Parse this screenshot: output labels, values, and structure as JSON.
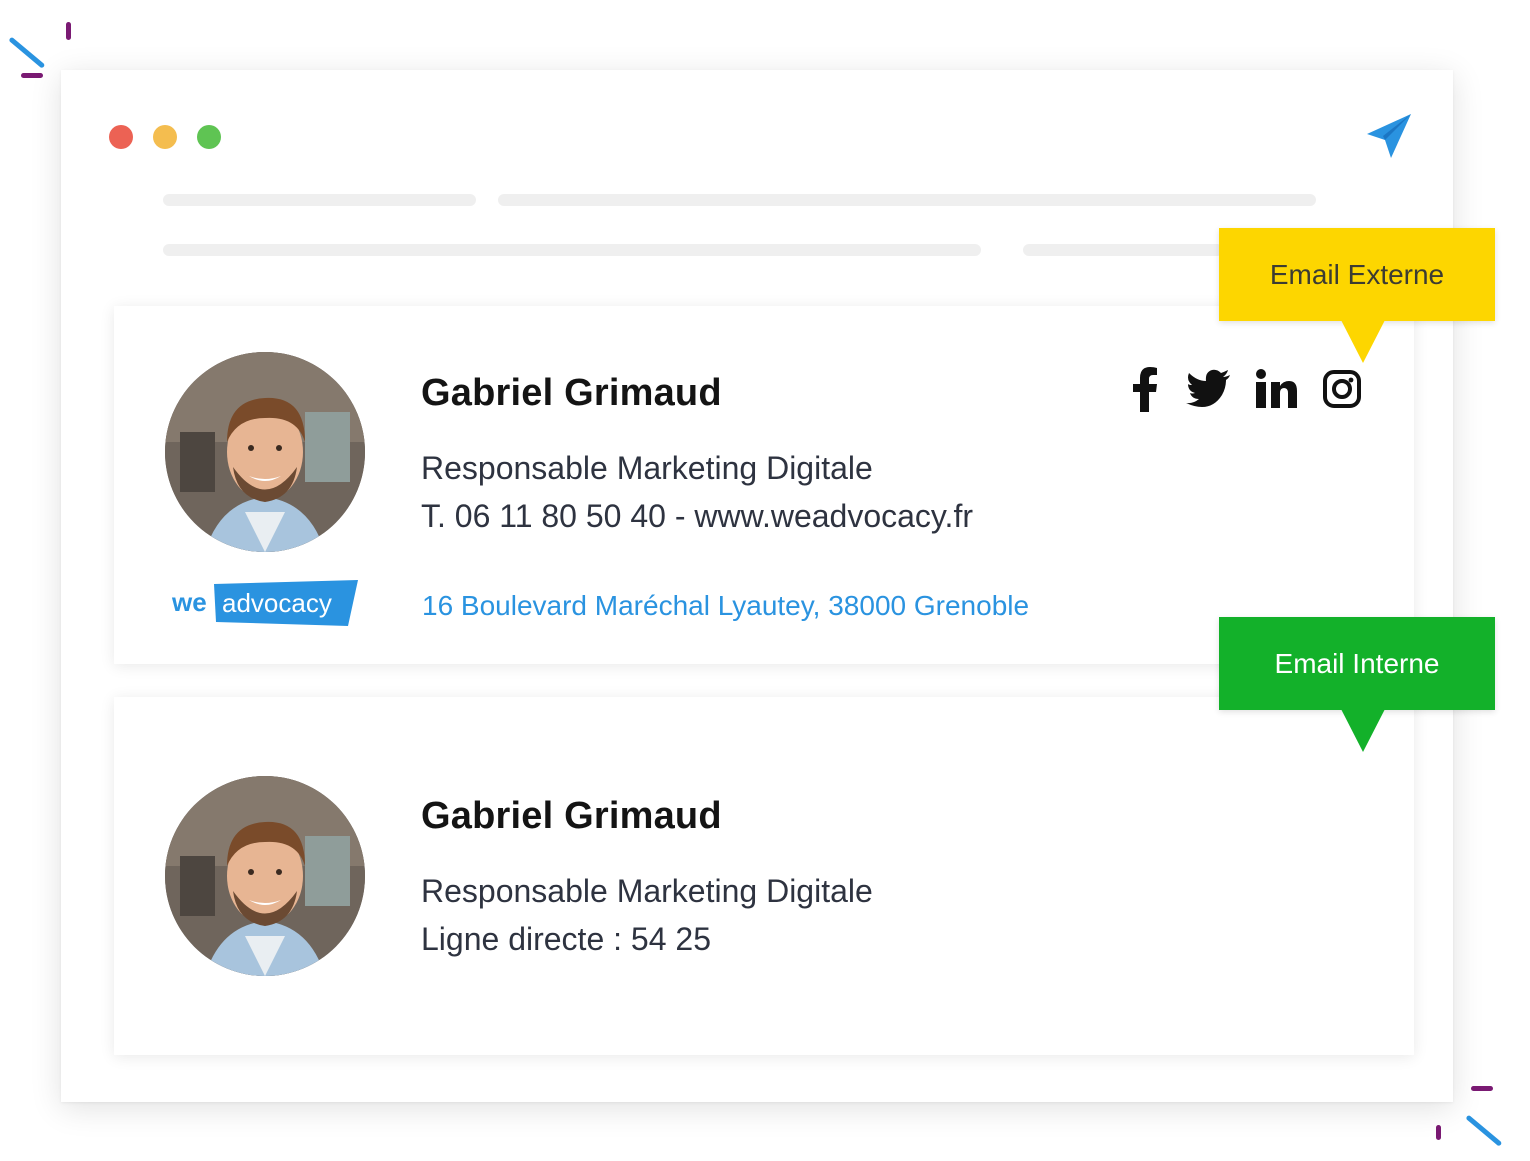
{
  "colors": {
    "link_blue": "#2a93e0",
    "externe_label_bg": "#fdd600",
    "interne_label_bg": "#13b12a",
    "window_dot_red": "#ec6254",
    "window_dot_yellow": "#f4bd4f",
    "window_dot_green": "#5fc453"
  },
  "toolbar": {
    "send_icon": "paper-plane-icon"
  },
  "labels": {
    "externe": "Email Externe",
    "interne": "Email Interne"
  },
  "signature_externe": {
    "name": "Gabriel Grimaud",
    "title": "Responsable Marketing Digitale",
    "contact": "T. 06 11 80 50 40 - www.weadvocacy.fr",
    "address": "16 Boulevard Maréchal Lyautey, 38000 Grenoble",
    "logo": {
      "part1": "we",
      "part2": "advocacy"
    },
    "social": [
      "facebook-icon",
      "twitter-icon",
      "linkedin-icon",
      "instagram-icon"
    ]
  },
  "signature_interne": {
    "name": "Gabriel Grimaud",
    "title": "Responsable Marketing Digitale",
    "direct_line": "Ligne directe : 54 25"
  }
}
